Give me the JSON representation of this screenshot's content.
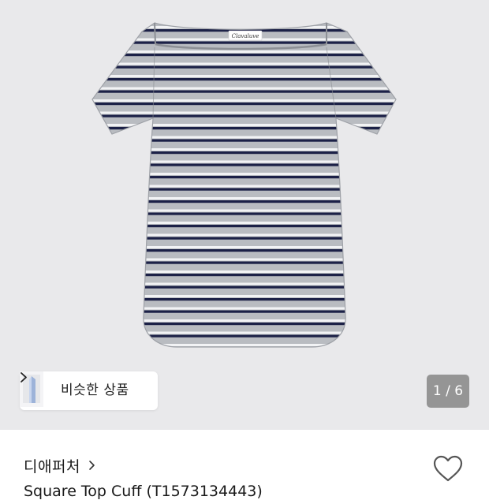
{
  "product_image": {
    "icon": "striped-tshirt",
    "body_color": "#b9bcc1",
    "navy_stripe": "#1c2147",
    "white_stripe": "#f2f3f5",
    "label_text": "Clavaluve"
  },
  "similar_products": {
    "label": "비슷한 상품",
    "icon": "chevron-right-icon"
  },
  "image_counter": {
    "current": "1",
    "total": "6",
    "text": "1 / 6"
  },
  "brand": {
    "name": "디애퍼처",
    "icon": "chevron-right-icon"
  },
  "wishlist": {
    "icon": "heart-icon"
  },
  "product": {
    "name_partial": "Square Top Cuff (T1573134443)"
  }
}
